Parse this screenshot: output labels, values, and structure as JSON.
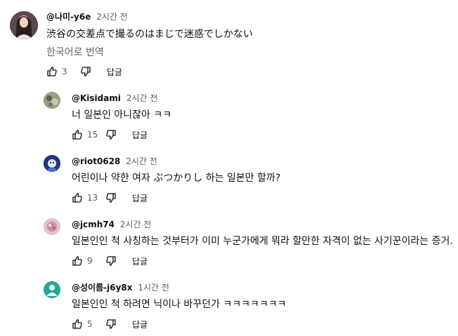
{
  "main_comment": {
    "author": "@나미-y6e",
    "time": "2시간 전",
    "text": "渋谷の交差点で撮るのはまじで迷惑でしかない",
    "translate_label": "한국어로 번역",
    "likes": "3",
    "reply_label": "답글"
  },
  "replies": [
    {
      "author": "@Kisidami",
      "time": "2시간 전",
      "text": "너 일본인 아니잖아 ㅋㅋ",
      "likes": "15",
      "reply_label": "답글",
      "avatar_color": "#8a8f72"
    },
    {
      "author": "@riot0628",
      "time": "2시간 전",
      "text": "어린이나 약한 여자 ぶつかりし 하는 일본만 할까?",
      "likes": "13",
      "reply_label": "답글",
      "avatar_color": "#2b3f8a"
    },
    {
      "author": "@jcmh74",
      "time": "2시간 전",
      "text": "일본인인 척 사칭하는 것부터가 이미 누군가에게 뭐라 할만한 자격이 없는 사기꾼이라는 증거.",
      "likes": "9",
      "reply_label": "답글",
      "avatar_color": "#d7a6b3"
    },
    {
      "author": "@성이름-j6y8x",
      "time": "1시간 전",
      "text": "일본인인 척 하려면 닉이나 바꾸던가 ㅋㅋㅋㅋㅋㅋㅋ",
      "likes": "5",
      "reply_label": "답글",
      "avatar_color": "#25a6a0"
    }
  ],
  "icons": {
    "like": "thumbs-up-icon",
    "dislike": "thumbs-down-icon"
  }
}
